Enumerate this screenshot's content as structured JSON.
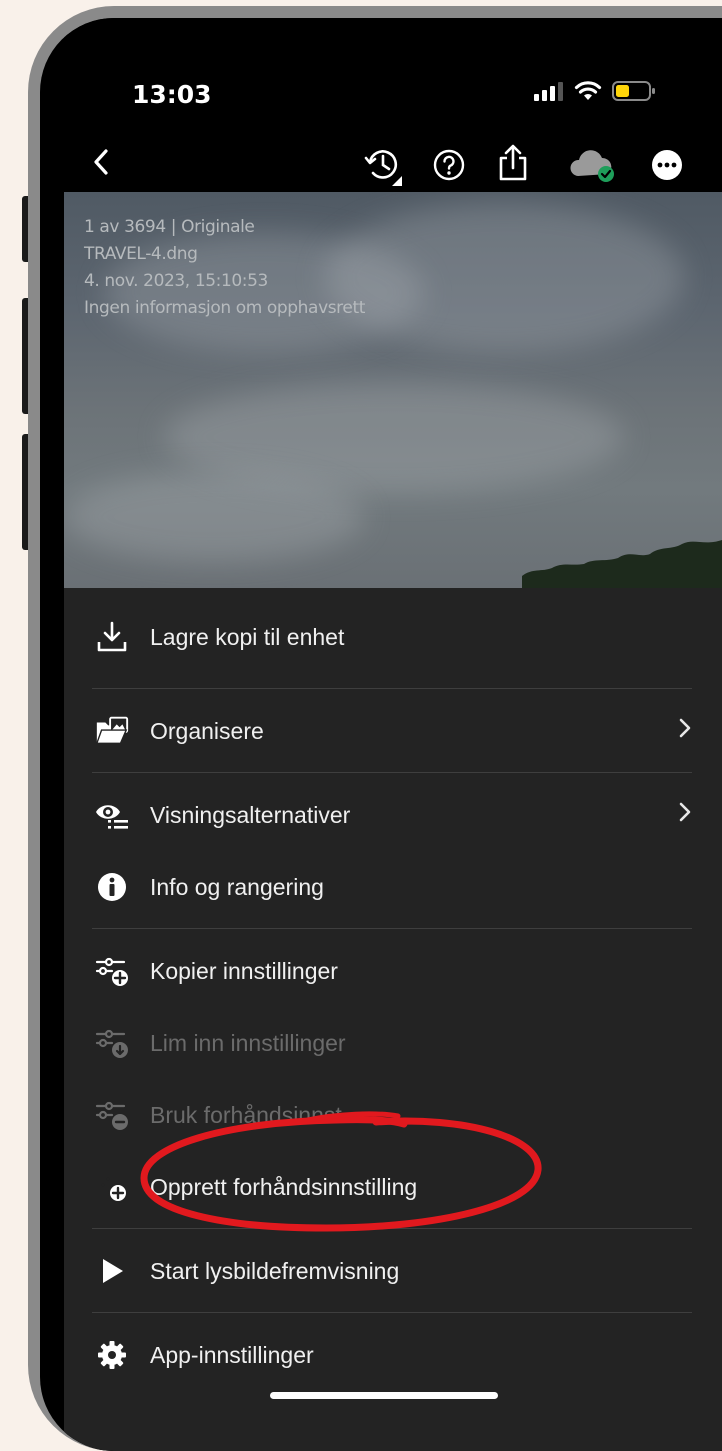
{
  "status": {
    "time": "13:03"
  },
  "photo": {
    "meta": [
      "1 av 3694 | Originale",
      "TRAVEL-4.dng",
      "4. nov. 2023, 15:10:53",
      "Ingen informasjon om opphavsrett"
    ]
  },
  "menu": {
    "save_copy": "Lagre kopi til enhet",
    "organize": "Organisere",
    "view_options": "Visningsalternativer",
    "info_rating": "Info og rangering",
    "copy_settings": "Kopier innstillinger",
    "paste_settings": "Lim inn innstillinger",
    "apply_preset": "Bruk forhåndsinnst.",
    "create_preset": "Opprett forhåndsinnstilling",
    "slideshow": "Start lysbildefremvisning",
    "app_settings": "App-innstillinger"
  },
  "colors": {
    "annotation": "#e1191e",
    "sheet": "#232323",
    "battery": "#ffd60a",
    "cloud_ok": "#1e9e5a"
  }
}
